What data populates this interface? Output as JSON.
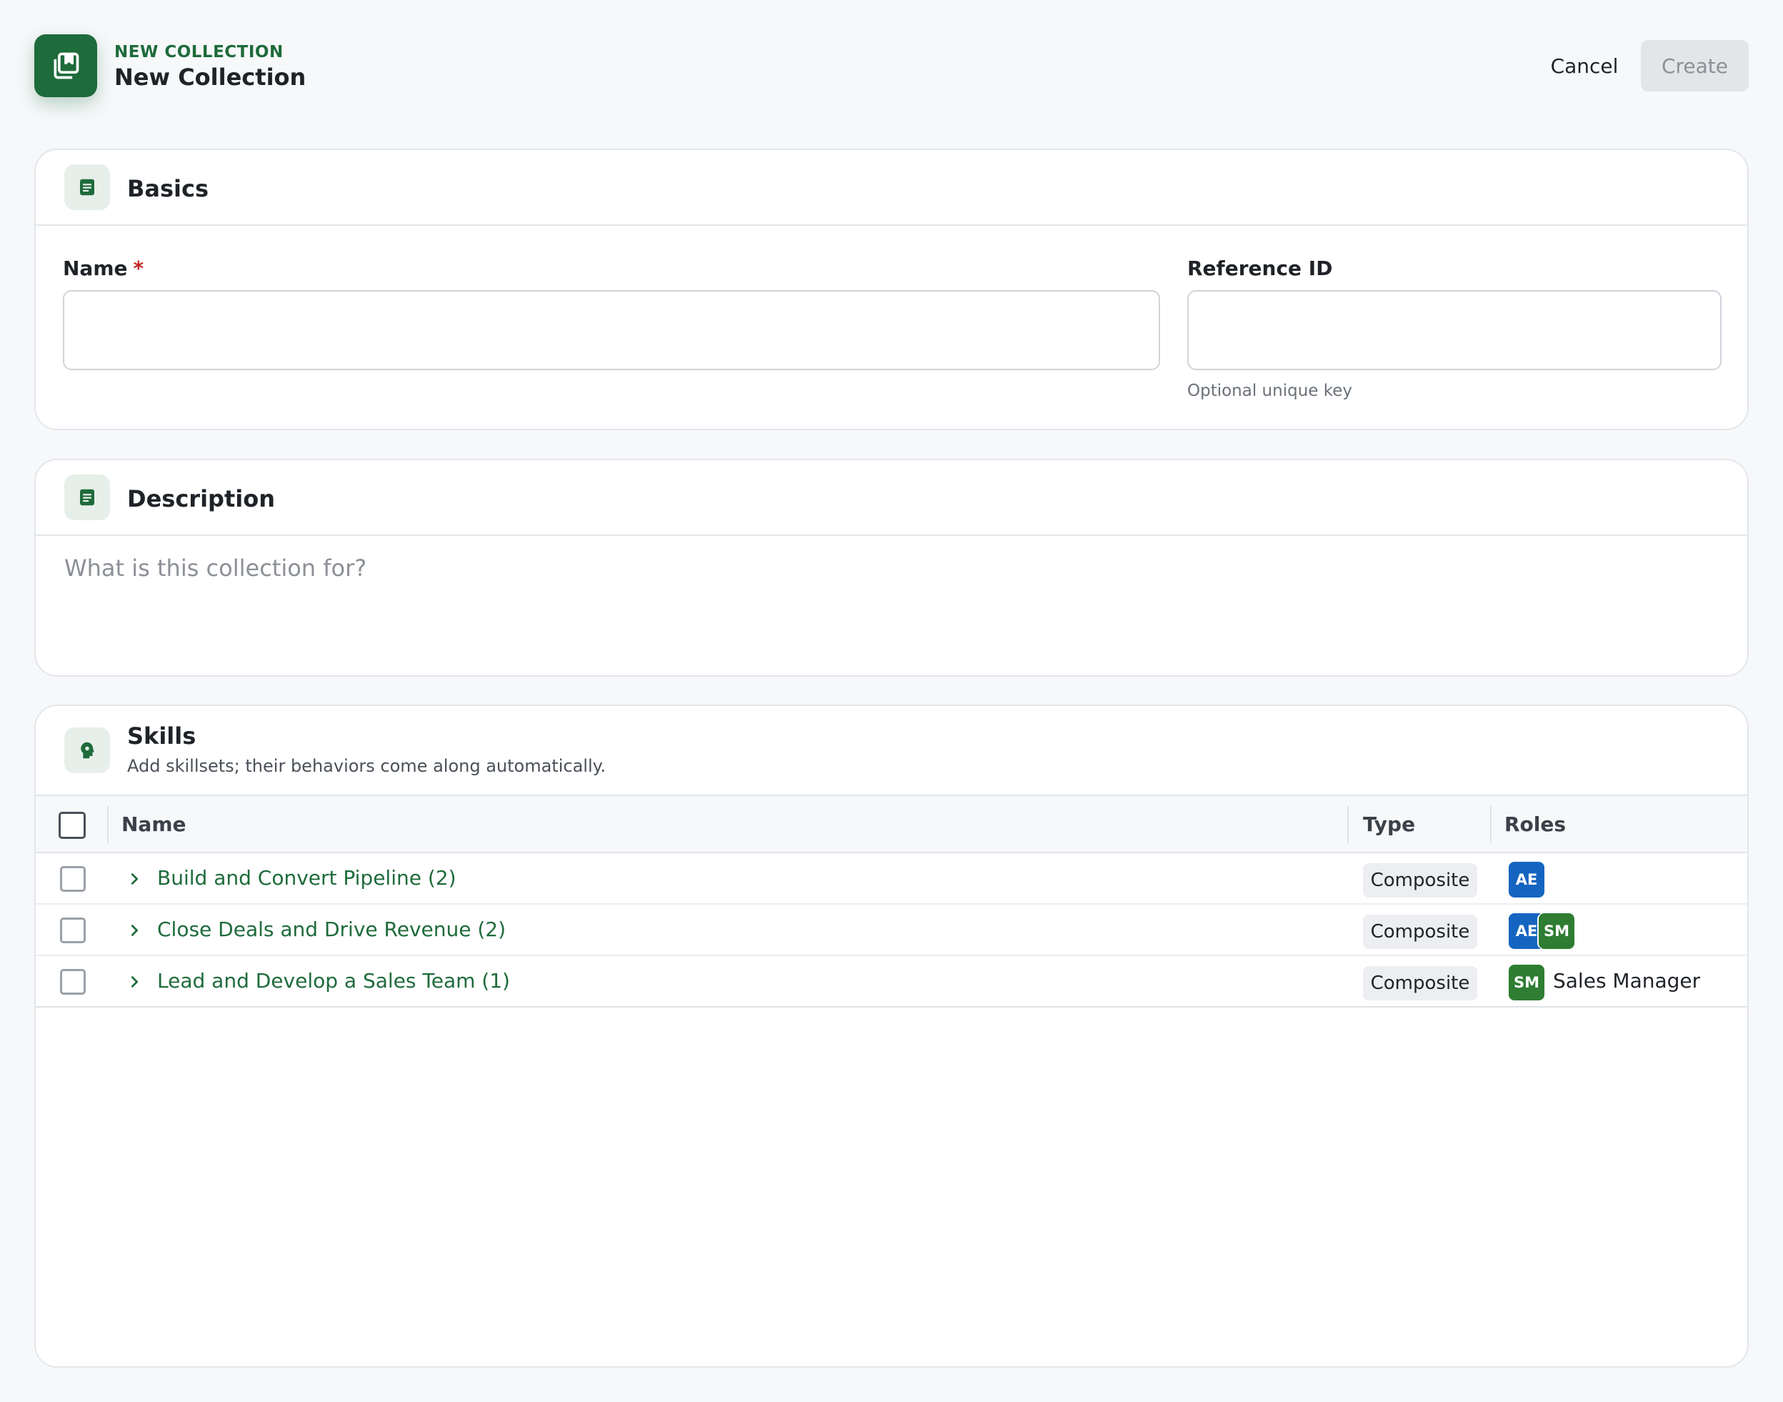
{
  "header": {
    "eyebrow": "NEW COLLECTION",
    "title": "New Collection",
    "cancel_label": "Cancel",
    "create_label": "Create"
  },
  "basics": {
    "title": "Basics",
    "name_label": "Name",
    "required_mark": "*",
    "name_value": "",
    "reference_label": "Reference ID",
    "reference_value": "",
    "reference_hint": "Optional unique key"
  },
  "description": {
    "title": "Description",
    "placeholder": "What is this collection for?"
  },
  "skills": {
    "title": "Skills",
    "subtitle": "Add skillsets; their behaviors come along automatically.",
    "columns": {
      "name": "Name",
      "type": "Type",
      "roles": "Roles"
    },
    "rows": [
      {
        "name": "Build and Convert Pipeline (2)",
        "type": "Composite",
        "roles": [
          "AE"
        ],
        "role_label": ""
      },
      {
        "name": "Close Deals and Drive Revenue (2)",
        "type": "Composite",
        "roles": [
          "AE",
          "SM"
        ],
        "role_label": ""
      },
      {
        "name": "Lead and Develop a Sales Team (1)",
        "type": "Composite",
        "roles": [
          "SM"
        ],
        "role_label": "Sales Manager"
      }
    ]
  },
  "colors": {
    "brand": "#1e6b3b",
    "role_ae": "#1565c0",
    "role_sm": "#2e7d32",
    "required": "#c62828"
  },
  "icons": {
    "app": "collection-icon",
    "basics": "document-icon",
    "description": "document-icon",
    "skills": "head-gear-icon",
    "row_expand": "chevron-right-icon"
  }
}
